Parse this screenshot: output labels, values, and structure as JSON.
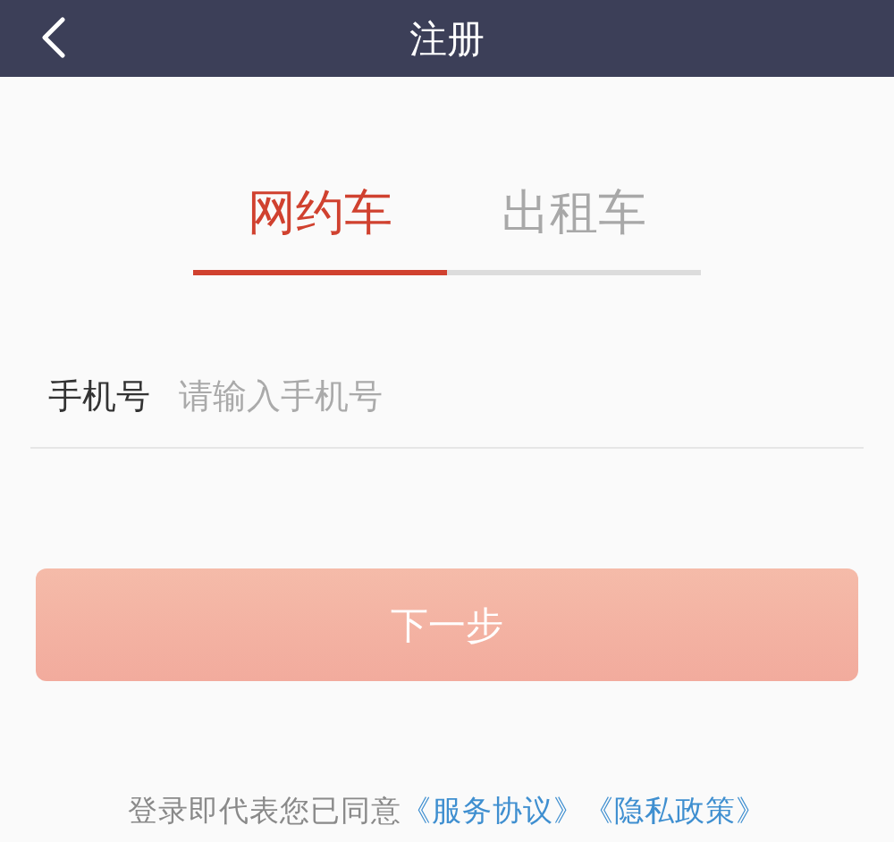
{
  "header": {
    "title": "注册"
  },
  "tabs": [
    {
      "label": "网约车",
      "selected": true
    },
    {
      "label": "出租车",
      "selected": false
    }
  ],
  "phone_field": {
    "label": "手机号",
    "placeholder": "请输入手机号"
  },
  "next_button": {
    "label": "下一步",
    "disabled": true
  },
  "agreement": {
    "text": "登录即代表您已同意",
    "links": [
      "《服务协议》",
      "《隐私政策》"
    ]
  }
}
